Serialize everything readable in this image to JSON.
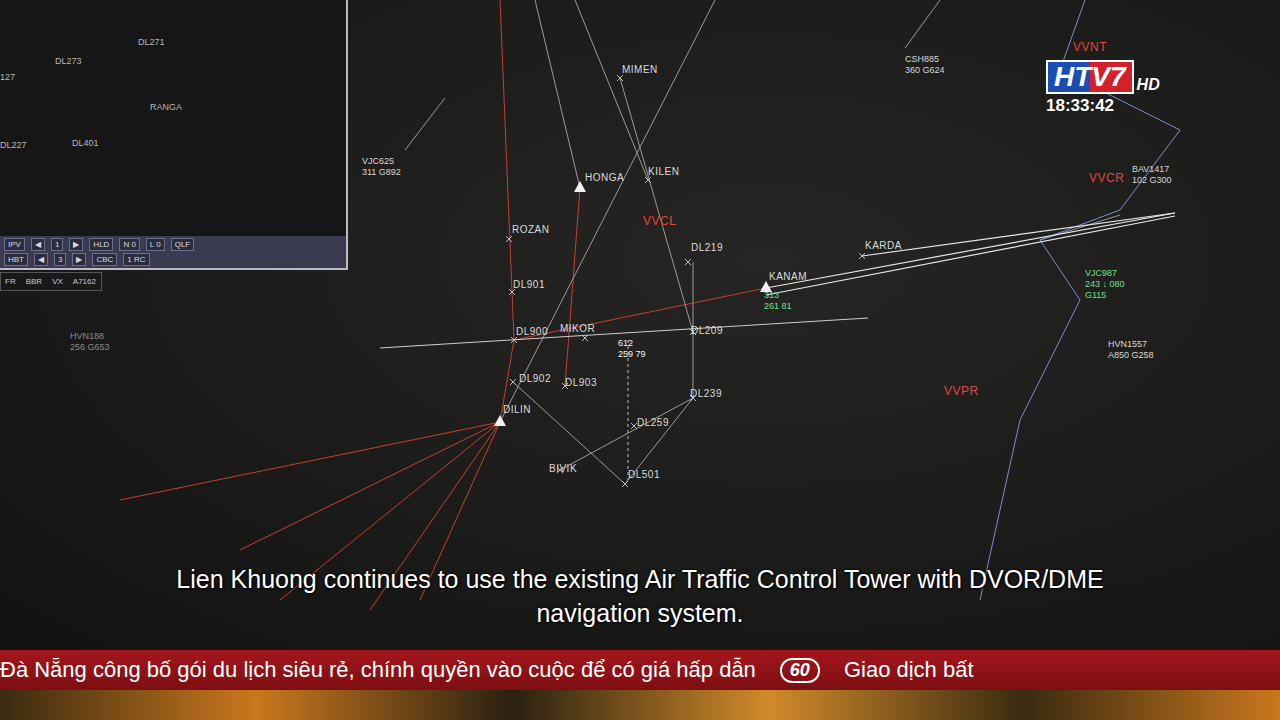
{
  "channel_logo": {
    "name": "HTV7",
    "suffix": "HD",
    "time": "18:33:42"
  },
  "inset_panel": {
    "labels": [
      "DL271",
      "DL273",
      "RANGA",
      "DL227",
      "DL401",
      "127"
    ],
    "toolbar": [
      [
        "IPV",
        "◀",
        "1",
        "▶",
        "HLD",
        "N 0",
        "L 0",
        "QLF"
      ],
      [
        "HBT",
        "◀",
        "3",
        "▶",
        "CBC",
        "1 RC"
      ]
    ],
    "info": [
      "FR",
      "BBR",
      "VX",
      "A7162"
    ]
  },
  "waypoints": [
    {
      "name": "MIMEN",
      "kind": "fix"
    },
    {
      "name": "HONGA",
      "kind": "triangle"
    },
    {
      "name": "KILEN",
      "kind": "fix"
    },
    {
      "name": "VVCL",
      "kind": "sector"
    },
    {
      "name": "ROZAN",
      "kind": "fix"
    },
    {
      "name": "DL219",
      "kind": "fix"
    },
    {
      "name": "KARDA",
      "kind": "fix"
    },
    {
      "name": "KANAM",
      "kind": "triangle"
    },
    {
      "name": "DL901",
      "kind": "fix"
    },
    {
      "name": "DL900",
      "kind": "fix"
    },
    {
      "name": "MIKOR",
      "kind": "fix"
    },
    {
      "name": "DL209",
      "kind": "fix"
    },
    {
      "name": "DL902",
      "kind": "fix"
    },
    {
      "name": "DL903",
      "kind": "fix"
    },
    {
      "name": "DL239",
      "kind": "fix"
    },
    {
      "name": "DILIN",
      "kind": "triangle"
    },
    {
      "name": "DL259",
      "kind": "fix"
    },
    {
      "name": "BIVIK",
      "kind": "fix"
    },
    {
      "name": "DL501",
      "kind": "fix"
    },
    {
      "name": "VVPR",
      "kind": "sector"
    },
    {
      "name": "VVNT",
      "kind": "sector"
    },
    {
      "name": "VVCR",
      "kind": "sector"
    }
  ],
  "aircraft": [
    {
      "lines": [
        "CSH885",
        "360  G624"
      ],
      "color": "#d8d8d8"
    },
    {
      "lines": [
        "VJC625",
        "311  G892"
      ],
      "color": "#d8d8d8"
    },
    {
      "lines": [
        "BAV1417",
        "102  G300"
      ],
      "color": "#d8d8d8"
    },
    {
      "lines": [
        "VJC987",
        "243 ↓ 080",
        "G115"
      ],
      "color": "#6fe08a"
    },
    {
      "lines": [
        "HVN1557",
        "A850  G258"
      ],
      "color": "#d8d8d8"
    },
    {
      "lines": [
        "HVN188",
        "256  G653"
      ],
      "color": "#8a8a8a"
    },
    {
      "lines": [
        "612",
        "259   79"
      ],
      "color": "#f2f2f2"
    },
    {
      "lines": [
        "313",
        "261   81"
      ],
      "color": "#6fe08a"
    }
  ],
  "subtitle": "Lien Khuong continues to use the existing Air Traffic Control Tower with DVOR/DME navigation system.",
  "ticker": {
    "headline": "Đà Nẵng công bố gói du lịch siêu rẻ, chính quyền vào cuộc để có giá hấp dẫn",
    "badge": "60",
    "next": "Giao dịch bất"
  }
}
